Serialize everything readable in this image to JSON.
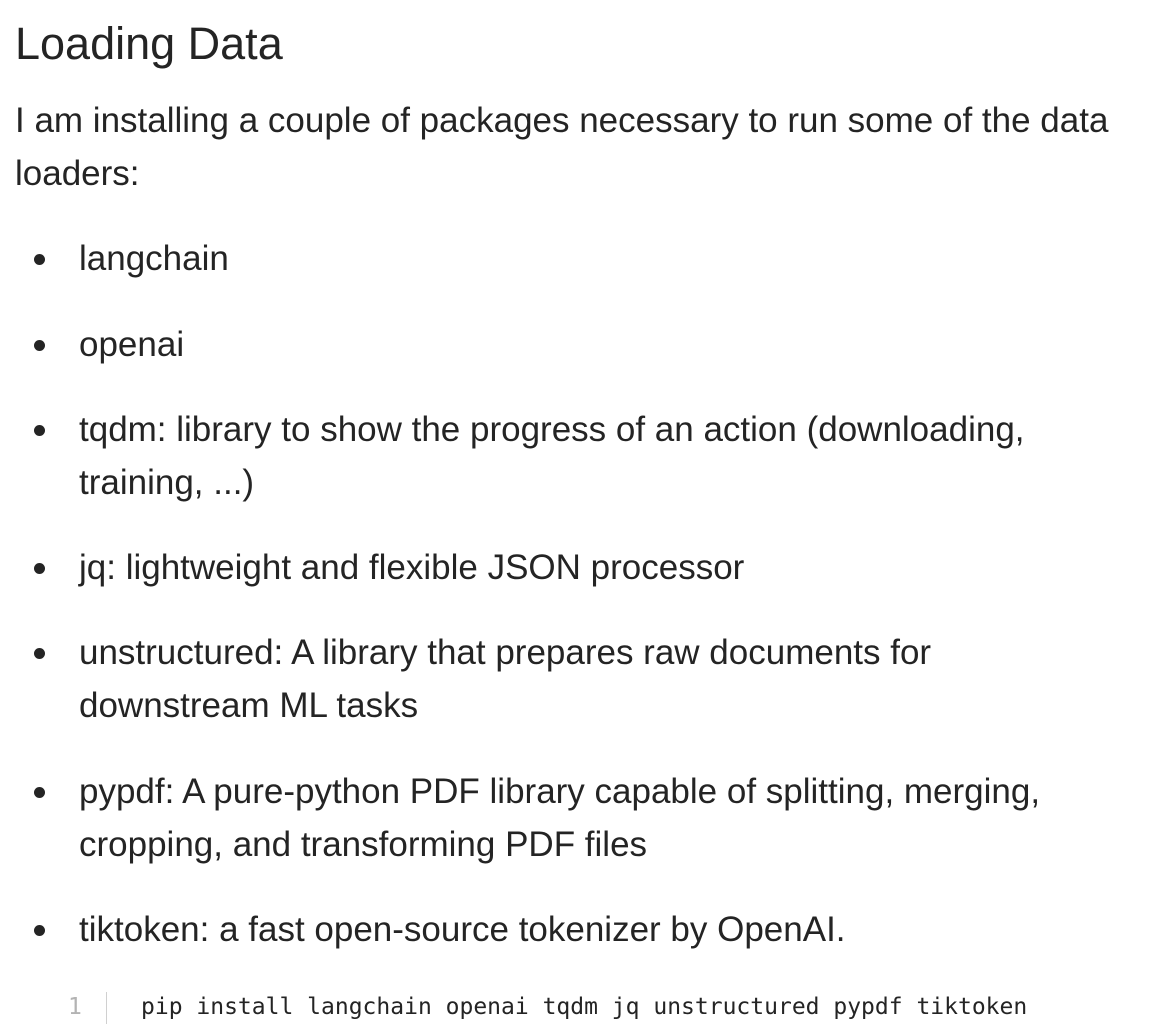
{
  "article": {
    "heading": "Loading Data",
    "intro": "I am installing a couple of packages necessary to run some of the data loaders:",
    "packages": [
      {
        "text": "langchain"
      },
      {
        "text": "openai"
      },
      {
        "text": "tqdm: library to show the progress of an action (downloading, training, ...)"
      },
      {
        "text": "jq: lightweight and flexible JSON processor"
      },
      {
        "text": "unstructured: A library that prepares raw documents for downstream ML tasks"
      },
      {
        "text": "pypdf: A pure-python PDF library capable of splitting, merging, cropping, and transforming PDF files"
      },
      {
        "text": "tiktoken: a fast open-source tokenizer by OpenAI."
      }
    ],
    "code": {
      "line_number": "1",
      "text": "pip install langchain openai tqdm jq unstructured pypdf tiktoken"
    }
  }
}
